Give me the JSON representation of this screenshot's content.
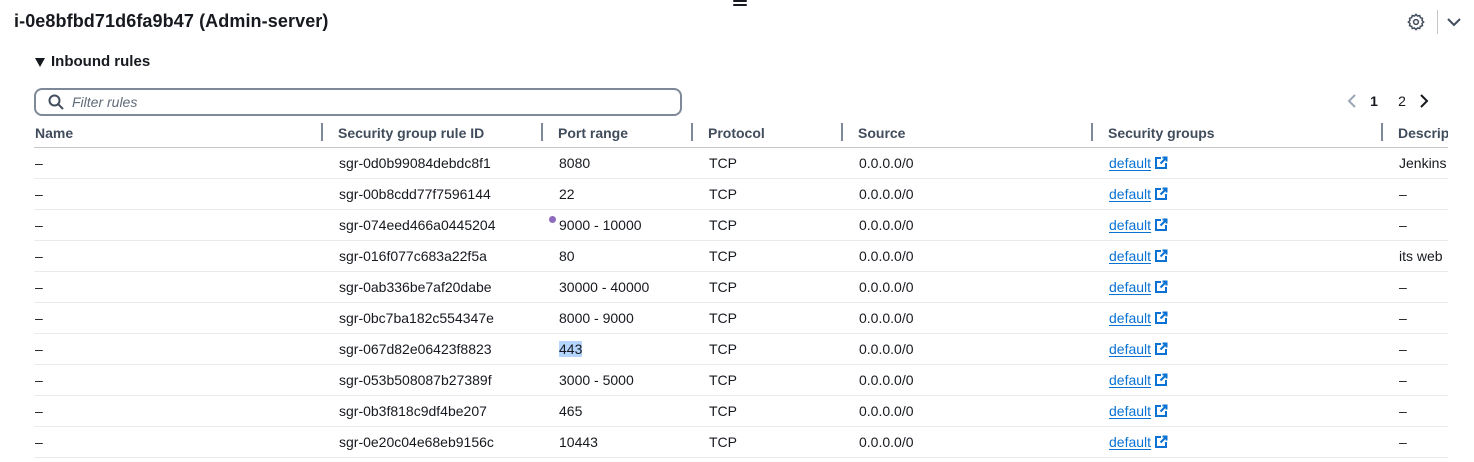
{
  "header": {
    "title": "i-0e8bfbd71d6fa9b47 (Admin-server)"
  },
  "section": {
    "title": "Inbound rules"
  },
  "filter": {
    "placeholder": "Filter rules",
    "value": ""
  },
  "pagination": {
    "pages": [
      "1",
      "2"
    ],
    "current": "1"
  },
  "table": {
    "columns": [
      "Name",
      "Security group rule ID",
      "Port range",
      "Protocol",
      "Source",
      "Security groups",
      "Descrip"
    ],
    "rows": [
      {
        "name": "–",
        "rule_id": "sgr-0d0b99084debdc8f1",
        "port_range": "8080",
        "protocol": "TCP",
        "source": "0.0.0.0/0",
        "security_group": "default",
        "description": "Jenkins"
      },
      {
        "name": "–",
        "rule_id": "sgr-00b8cdd77f7596144",
        "port_range": "22",
        "protocol": "TCP",
        "source": "0.0.0.0/0",
        "security_group": "default",
        "description": "–"
      },
      {
        "name": "–",
        "rule_id": "sgr-074eed466a0445204",
        "port_range": "9000 - 10000",
        "protocol": "TCP",
        "source": "0.0.0.0/0",
        "security_group": "default",
        "description": "–"
      },
      {
        "name": "–",
        "rule_id": "sgr-016f077c683a22f5a",
        "port_range": "80",
        "protocol": "TCP",
        "source": "0.0.0.0/0",
        "security_group": "default",
        "description": "its web"
      },
      {
        "name": "–",
        "rule_id": "sgr-0ab336be7af20dabe",
        "port_range": "30000 - 40000",
        "protocol": "TCP",
        "source": "0.0.0.0/0",
        "security_group": "default",
        "description": "–"
      },
      {
        "name": "–",
        "rule_id": "sgr-0bc7ba182c554347e",
        "port_range": "8000 - 9000",
        "protocol": "TCP",
        "source": "0.0.0.0/0",
        "security_group": "default",
        "description": "–"
      },
      {
        "name": "–",
        "rule_id": "sgr-067d82e06423f8823",
        "port_range": "443",
        "protocol": "TCP",
        "source": "0.0.0.0/0",
        "security_group": "default",
        "description": "–"
      },
      {
        "name": "–",
        "rule_id": "sgr-053b508087b27389f",
        "port_range": "3000 - 5000",
        "protocol": "TCP",
        "source": "0.0.0.0/0",
        "security_group": "default",
        "description": "–"
      },
      {
        "name": "–",
        "rule_id": "sgr-0b3f818c9df4be207",
        "port_range": "465",
        "protocol": "TCP",
        "source": "0.0.0.0/0",
        "security_group": "default",
        "description": "–"
      },
      {
        "name": "–",
        "rule_id": "sgr-0e20c04e68eb9156c",
        "port_range": "10443",
        "protocol": "TCP",
        "source": "0.0.0.0/0",
        "security_group": "default",
        "description": "–"
      }
    ],
    "selected_row_index": 6
  },
  "icons": {
    "drag_handle": "drag-handle-icon",
    "settings": "gear-icon",
    "collapse": "chevron-down-icon",
    "section_caret": "caret-down-icon",
    "search": "search-icon",
    "prev": "chevron-left-icon",
    "next": "chevron-right-icon",
    "external": "external-link-icon"
  },
  "colors": {
    "link": "#0972d3",
    "text": "#16191f",
    "header_text": "#414d5c",
    "selection": "#b4d5fe",
    "disabled": "#9ba7b6",
    "cursor_dot": "#8d6cbf"
  }
}
